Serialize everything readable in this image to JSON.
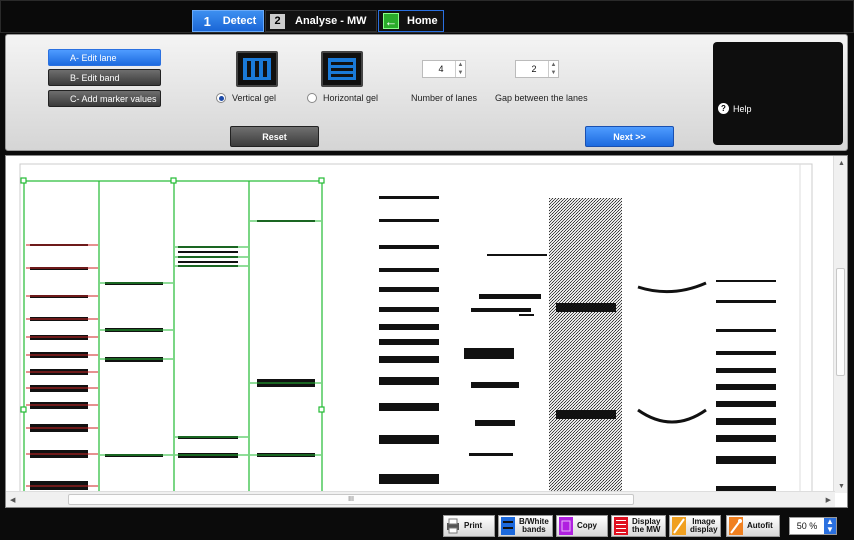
{
  "top_tabs": {
    "detect": {
      "num": "1",
      "label": "Detect"
    },
    "analyse": {
      "num": "2",
      "label": "Analyse - MW"
    },
    "home": {
      "label": "Home"
    }
  },
  "mode_buttons": [
    "A- Edit lane",
    "B- Edit band",
    "C- Add marker values"
  ],
  "gel_orientation": {
    "vertical_label": "Vertical gel",
    "horizontal_label": "Horizontal gel",
    "selected": "vertical"
  },
  "lanes": {
    "count_label": "Number of lanes",
    "count_value": "4",
    "gap_label": "Gap between the lanes",
    "gap_value": "2"
  },
  "buttons": {
    "reset": "Reset",
    "next": "Next >>",
    "help": "Help"
  },
  "viewer": {
    "hscroll_grip": "III"
  },
  "toolbar": {
    "print": "Print",
    "bw_bands": [
      "B/White",
      "bands"
    ],
    "copy": "Copy",
    "display_mw": [
      "Display",
      "the MW"
    ],
    "image_display": [
      "Image",
      "display"
    ],
    "autofit": "Autofit",
    "zoom": "50 %"
  },
  "colors": {
    "accent_blue": "#1c6adf",
    "lane_green": "#22bb33",
    "band_red": "#cc2222",
    "copy_purple": "#b020e0",
    "mw_red": "#e01020",
    "image_orange": "#f0a020"
  }
}
